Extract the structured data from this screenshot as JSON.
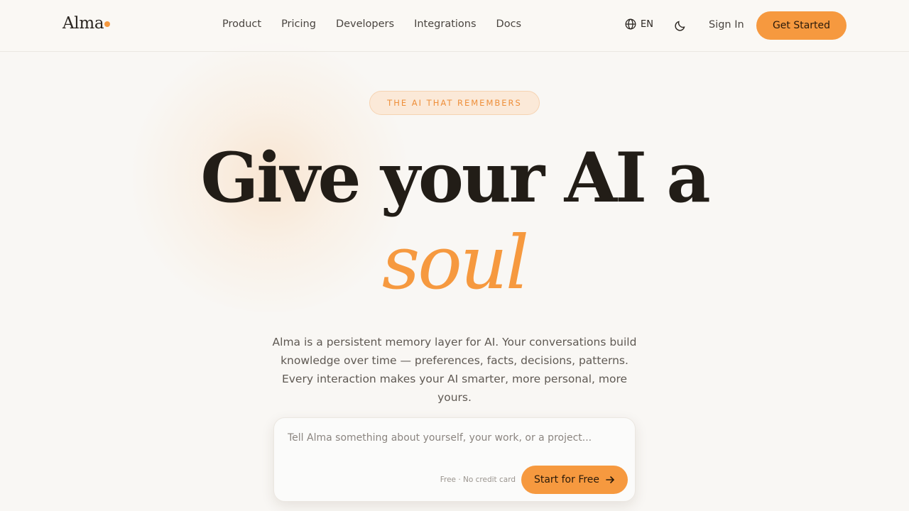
{
  "brand": {
    "name": "Alma",
    "accent_color": "#f6993f"
  },
  "nav": {
    "links": [
      "Product",
      "Pricing",
      "Developers",
      "Integrations",
      "Docs"
    ],
    "language": "EN",
    "language_icon": "globe-icon",
    "theme_icon": "moon-icon",
    "sign_in": "Sign In",
    "get_started": "Get Started"
  },
  "hero": {
    "badge": "THE AI THAT REMEMBERS",
    "headline": "Give your AI a",
    "headline_accent": "soul",
    "description": "Alma is a persistent memory layer for AI. Your conversations build knowledge over time — preferences, facts, decisions, patterns. Every interaction makes your AI smarter, more personal, more yours."
  },
  "prompt": {
    "placeholder": "Tell Alma something about yourself, your work, or a project...",
    "value": "",
    "note": "Free · No credit card",
    "submit_label": "Start for Free",
    "submit_icon": "arrow-right-icon"
  }
}
